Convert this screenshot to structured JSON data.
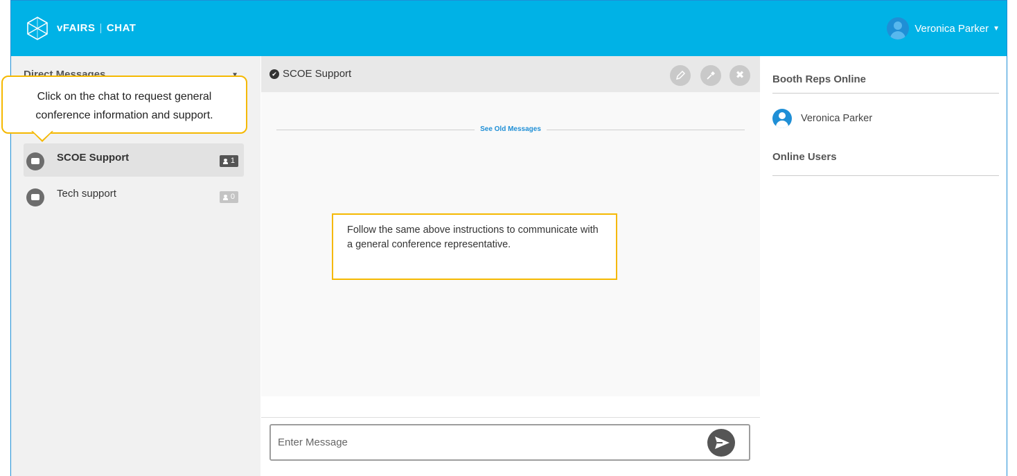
{
  "header": {
    "brand": "vFAIRS",
    "separator": "|",
    "product": "CHAT",
    "logo_icon": "cube-icon",
    "user_name": "Veronica Parker",
    "accent_color": "#00b2e6"
  },
  "sidebar": {
    "section_title": "Direct Messages",
    "rooms": [
      {
        "name": "SCOE Support",
        "count": "1",
        "active": true,
        "icon": "chat-bubble-icon"
      },
      {
        "name": "Tech support",
        "count": "0",
        "active": false,
        "icon": "chat-bubble-icon"
      }
    ]
  },
  "tooltip": {
    "text_line1": "Click on the chat to request general",
    "text_line2": "conference information and support.",
    "border_color": "#f5b800"
  },
  "chat": {
    "title": "SCOE Support",
    "actions": [
      "pencil-icon",
      "eyedropper-icon",
      "close-icon"
    ],
    "see_old_messages": "See Old Messages",
    "note": "Follow the same above instructions to communicate with a general conference representative.",
    "input_placeholder": "Enter Message"
  },
  "right_panel": {
    "booth_reps_title": "Booth Reps Online",
    "reps": [
      {
        "name": "Veronica Parker"
      }
    ],
    "online_users_title": "Online Users"
  }
}
